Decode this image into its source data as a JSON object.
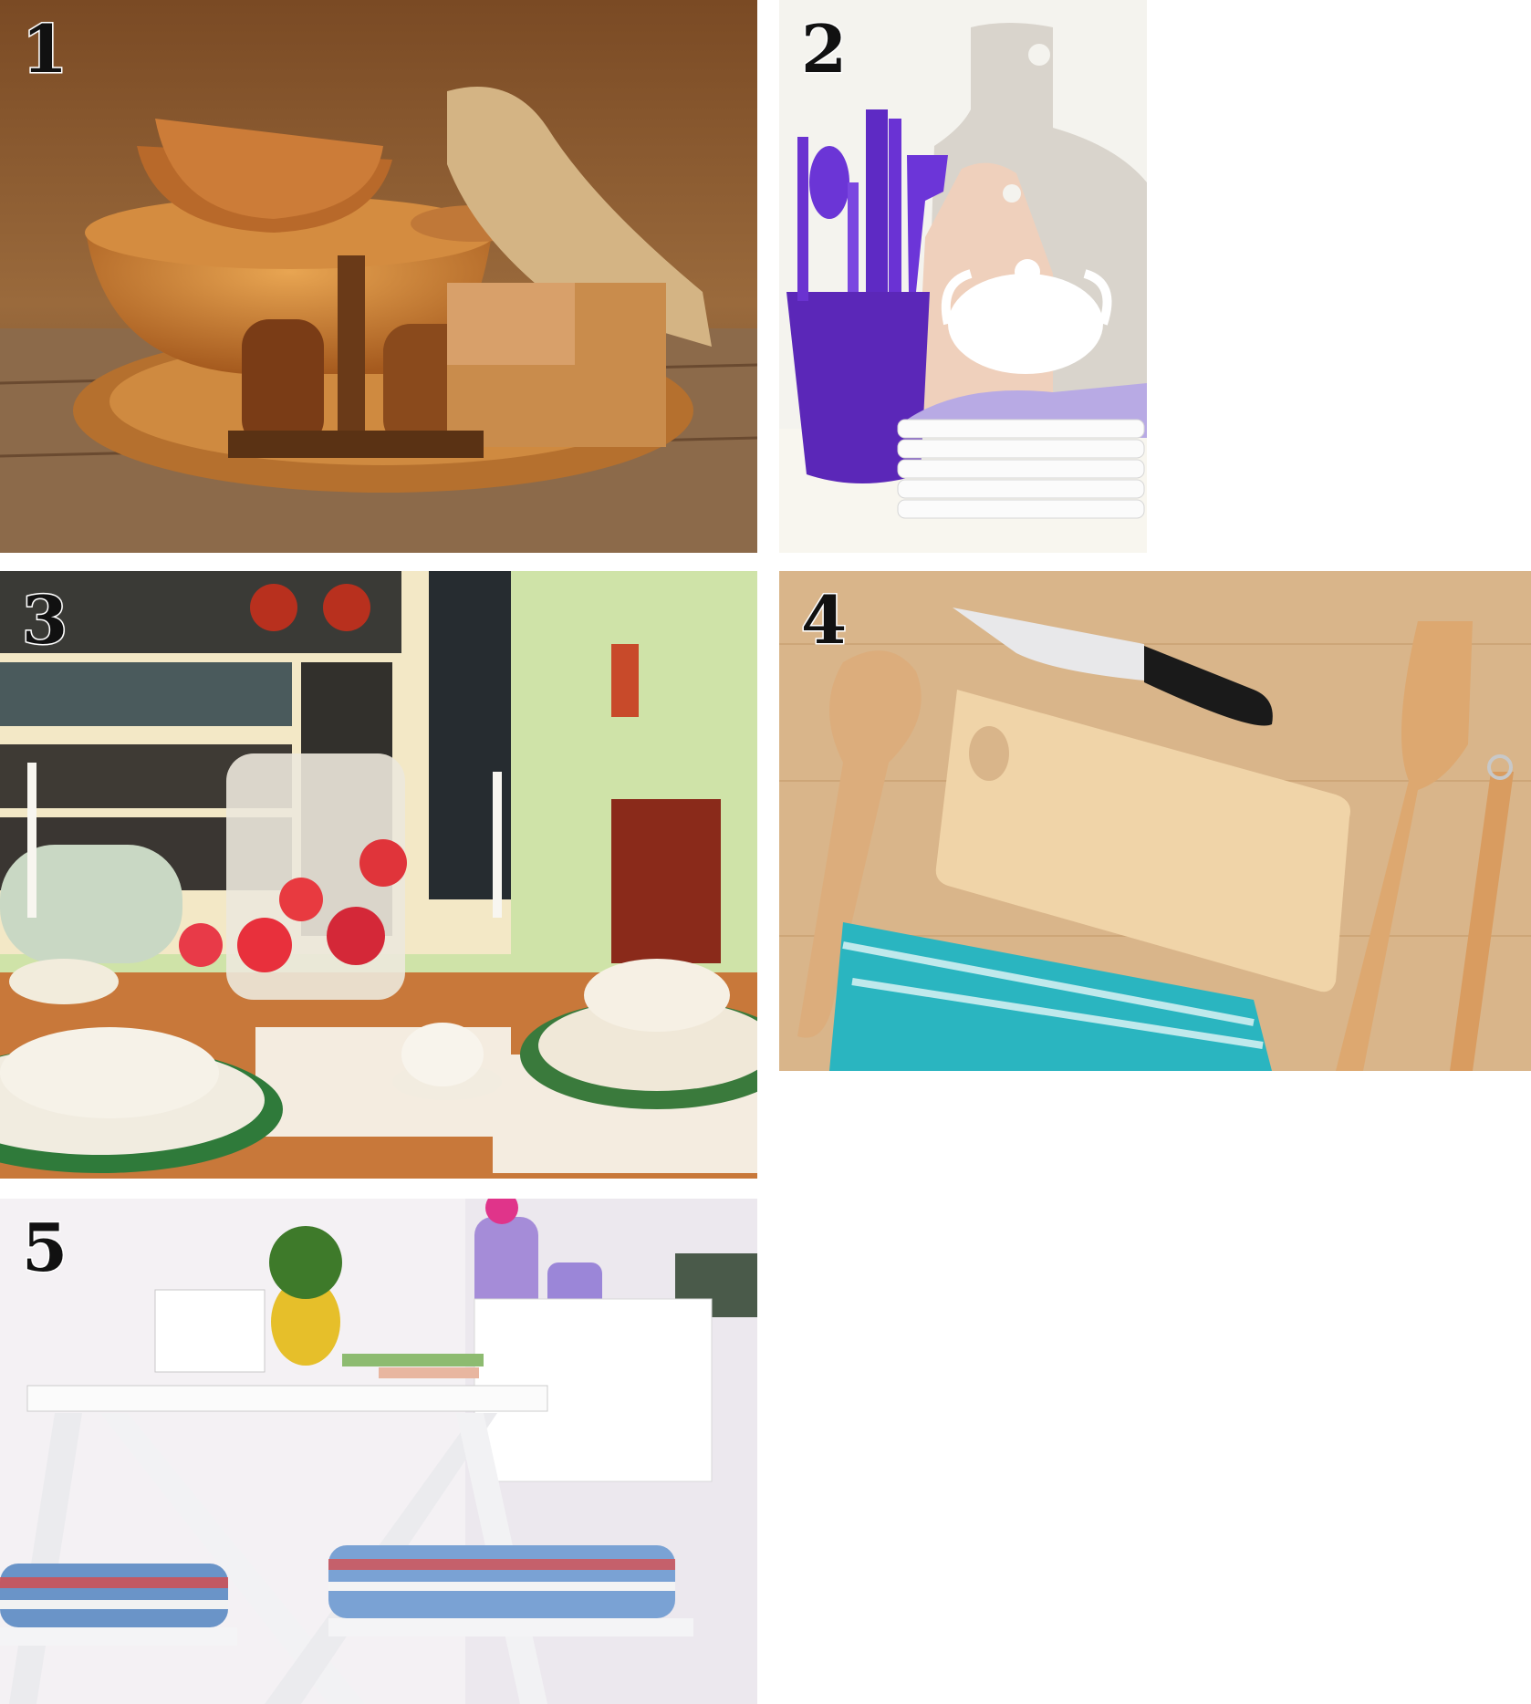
{
  "panels": [
    {
      "number": "1",
      "subject": "wooden-kitchenware"
    },
    {
      "number": "2",
      "subject": "purple-utensils-and-white-dishes"
    },
    {
      "number": "3",
      "subject": "set-dining-table"
    },
    {
      "number": "4",
      "subject": "wooden-utensils-and-cutting-board"
    },
    {
      "number": "5",
      "subject": "white-garden-table-and-chairs"
    }
  ]
}
